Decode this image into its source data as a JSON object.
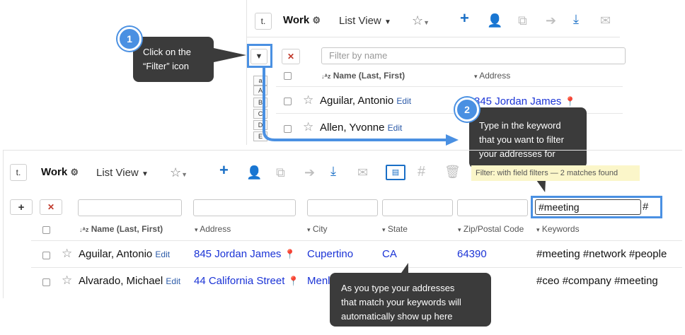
{
  "top_panel": {
    "collapse_label": "t.",
    "work_label": "Work",
    "list_view_label": "List View",
    "filter_placeholder": "Filter by name",
    "col_name": "Name (Last, First)",
    "col_address": "Address",
    "az": [
      "a",
      "A",
      "B",
      "C",
      "D",
      "E"
    ],
    "rows": [
      {
        "name": "Aguilar, Antonio",
        "edit": "Edit",
        "address": "845 Jordan James"
      },
      {
        "name": "Allen, Yvonne",
        "edit": "Edit"
      }
    ]
  },
  "bottom_panel": {
    "collapse_label": "t.",
    "work_label": "Work",
    "list_view_label": "List View",
    "filter_status": "Filter: with field filters — 2 matches found",
    "keyword_value": "#meeting",
    "hash_label": "#",
    "columns": {
      "name": "Name (Last, First)",
      "address": "Address",
      "city": "City",
      "state": "State",
      "zip": "Zip/Postal Code",
      "keywords": "Keywords"
    },
    "rows": [
      {
        "name": "Aguilar, Antonio",
        "edit": "Edit",
        "address": "845 Jordan James",
        "city": "Cupertino",
        "state": "CA",
        "zip": "64390",
        "keywords": "#meeting #network #people"
      },
      {
        "name": "Alvarado, Michael",
        "edit": "Edit",
        "address": "44 California Street",
        "city": "Menl",
        "state": "",
        "zip": "",
        "keywords": "#ceo #company #meeting"
      }
    ]
  },
  "callouts": {
    "step1_number": "1",
    "step1_text_line1": "Click on the",
    "step1_text_line2": "“Filter” icon",
    "step2_number": "2",
    "step2_line1": "Type in the keyword",
    "step2_line2": "that you want to filter",
    "step2_line3": "your addresses for",
    "step3_line1": "As you type your addresses",
    "step3_line2": "that match your keywords will",
    "step3_line3": "automatically show up here"
  },
  "colors": {
    "accent": "#4a90e2",
    "link": "#1a33d6",
    "callout_bg": "#3b3b3b",
    "filter_status_bg": "#fbf6c9"
  }
}
